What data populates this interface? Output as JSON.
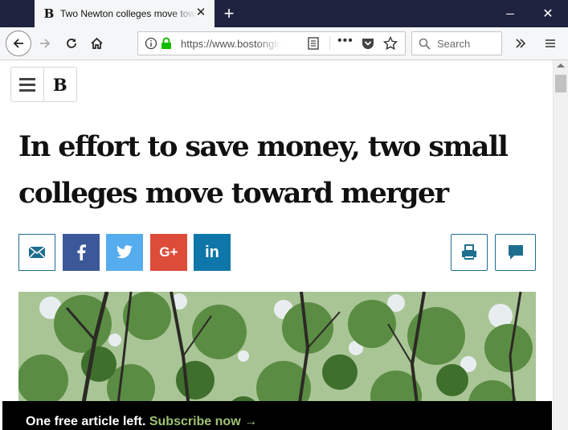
{
  "browser": {
    "tab": {
      "favicon_text": "B",
      "title": "Two Newton colleges move toward merger"
    },
    "url": "https://www.bostonglobe.com",
    "search_placeholder": "Search"
  },
  "site": {
    "logo_text": "B"
  },
  "article": {
    "headline_line1": "In effort to save money, two small",
    "headline_line2": "colleges move toward merger"
  },
  "share": {
    "google_plus_label": "G+",
    "linkedin_label": "in"
  },
  "paywall": {
    "message": "One free article left.",
    "link": "Subscribe now →"
  },
  "colors": {
    "facebook": "#3b5998",
    "twitter": "#55acee",
    "google_plus": "#dd4b39",
    "linkedin": "#0e76a8",
    "outline_accent": "#1e6e8f",
    "subscribe_link": "#9ec173"
  }
}
